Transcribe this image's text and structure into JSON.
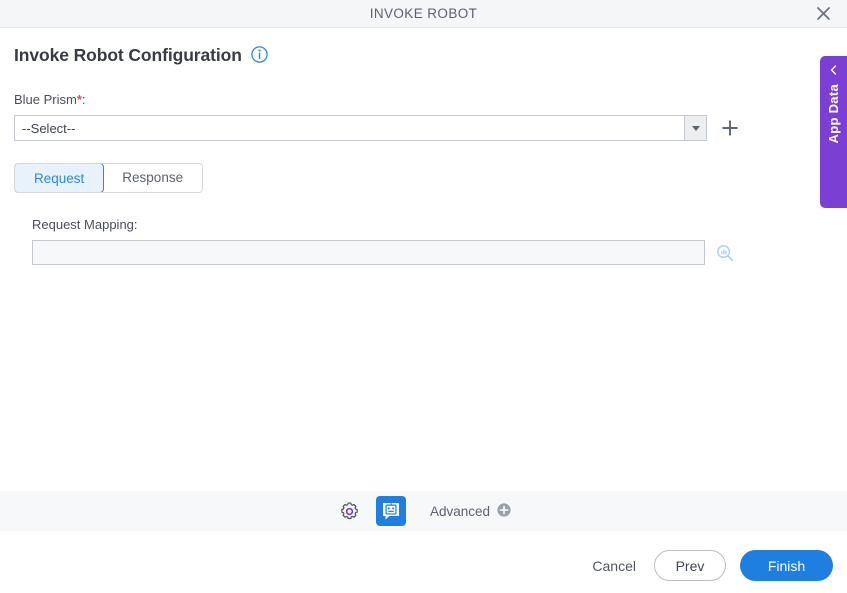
{
  "window": {
    "title": "INVOKE ROBOT",
    "close_icon": "close-icon"
  },
  "page": {
    "heading": "Invoke Robot Configuration",
    "info_icon": "info-icon"
  },
  "form": {
    "blue_prism": {
      "label": "Blue Prism",
      "required_marker": "*",
      "label_suffix": ":",
      "selected_value": "--Select--",
      "add_icon": "plus-icon",
      "dropdown_icon": "caret-down-icon"
    }
  },
  "tabs": [
    {
      "label": "Request",
      "active": true
    },
    {
      "label": "Response",
      "active": false
    }
  ],
  "request_panel": {
    "mapping_label": "Request Mapping:",
    "mapping_value": "",
    "mapping_placeholder": "",
    "search_icon": "magnifier-icon"
  },
  "app_data": {
    "label": "App Data",
    "chevron_icon": "chevron-left-icon",
    "color": "#7b3fd4"
  },
  "toolbar": {
    "settings_icon": "gear-icon",
    "robot_icon": "robot-chat-icon",
    "advanced_label": "Advanced",
    "advanced_add_icon": "plus-circle-icon",
    "accent": "#1e7fe0"
  },
  "footer": {
    "cancel_label": "Cancel",
    "prev_label": "Prev",
    "finish_label": "Finish"
  }
}
